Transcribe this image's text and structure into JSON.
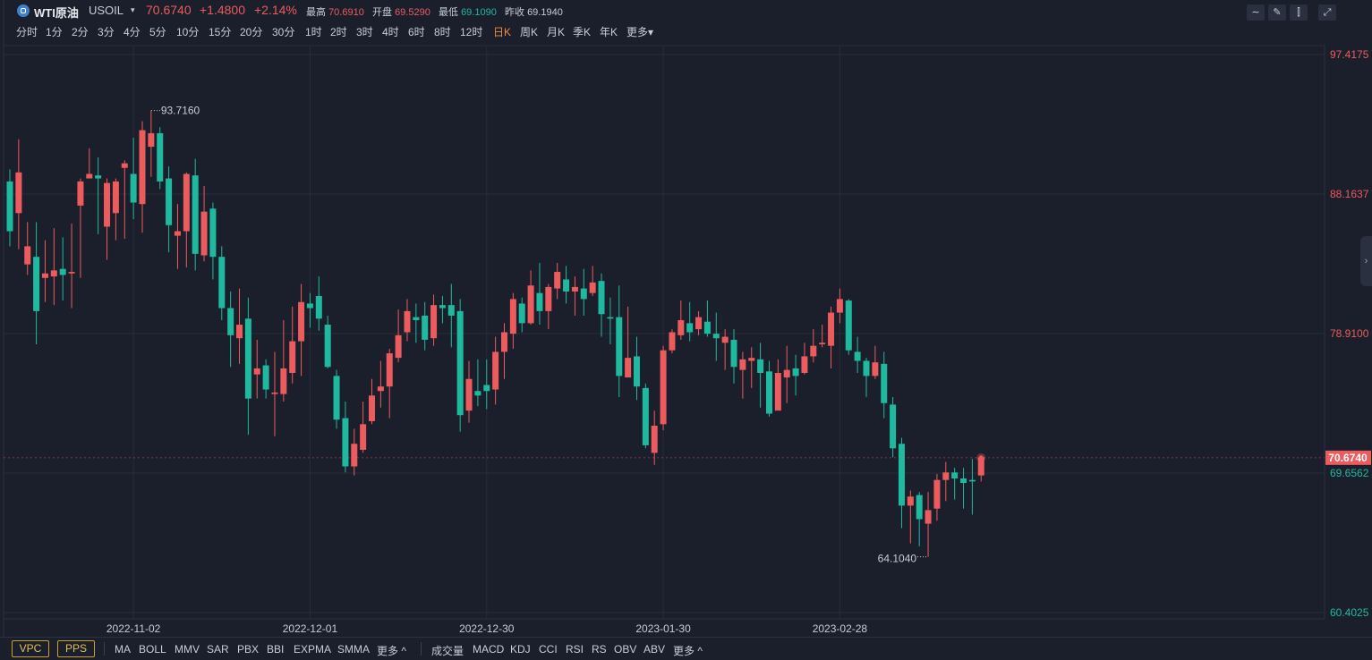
{
  "header": {
    "symbol_name": "WTI原油",
    "symbol_code": "USOIL",
    "caret": "▾",
    "last_price": "70.6740",
    "change": "+1.4800",
    "change_pct": "+2.14%",
    "high_label": "最高",
    "high_value": "70.6910",
    "open_label": "开盘",
    "open_value": "69.5290",
    "low_label": "最低",
    "low_value": "69.1090",
    "prev_close_label": "昨收",
    "prev_close_value": "69.1940"
  },
  "tools": [
    "line-tool-icon",
    "pencil-icon",
    "candle-style-icon",
    "fullscreen-icon"
  ],
  "periods": [
    "分时",
    "1分",
    "2分",
    "3分",
    "4分",
    "5分",
    "10分",
    "15分",
    "20分",
    "30分",
    "1时",
    "2时",
    "3时",
    "4时",
    "6时",
    "8时",
    "12时",
    "日K",
    "周K",
    "月K",
    "季K",
    "年K",
    "更多▾"
  ],
  "active_period": "日K",
  "bottom": {
    "left_boxed": [
      "VPC",
      "PPS"
    ],
    "main_indicators": [
      "MA",
      "BOLL",
      "MMV",
      "SAR",
      "PBX",
      "BBI",
      "EXPMA",
      "SMMA",
      "更多 ^"
    ],
    "sub_indicators": [
      "成交量",
      "MACD",
      "KDJ",
      "CCI",
      "RSI",
      "RS",
      "OBV",
      "ABV",
      "更多 ^"
    ]
  },
  "colors": {
    "up": "#ec5b5e",
    "down": "#1fb9a0",
    "bg": "#1b1f2b",
    "grid": "#262c3a"
  },
  "chart_data": {
    "type": "candlestick",
    "ylim": [
      60.4025,
      97.4175
    ],
    "y_ticks": [
      "97.4175",
      "88.1637",
      "78.9100",
      "69.6562",
      "60.4025"
    ],
    "x_ticks": [
      "2022-11-02",
      "2022-12-01",
      "2022-12-30",
      "2023-01-30",
      "2023-02-28"
    ],
    "max_label": "93.7160",
    "min_label": "64.1040",
    "last_price_label": "70.6740",
    "candles": [
      [
        89.0,
        85.7,
        89.8,
        84.7
      ],
      [
        86.9,
        89.6,
        91.8,
        84.5
      ],
      [
        83.5,
        84.7,
        86.3,
        82.8
      ],
      [
        84.0,
        80.4,
        86.3,
        78.2
      ],
      [
        82.6,
        82.9,
        85.1,
        81.0
      ],
      [
        82.7,
        83.1,
        85.9,
        80.8
      ],
      [
        83.2,
        82.8,
        85.3,
        81.1
      ],
      [
        82.9,
        83.0,
        86.2,
        80.6
      ],
      [
        87.4,
        89.0,
        89.2,
        82.6
      ],
      [
        89.2,
        89.5,
        91.2,
        89.4
      ],
      [
        89.4,
        89.2,
        90.6,
        85.5
      ],
      [
        86.0,
        88.9,
        89.2,
        83.8
      ],
      [
        86.9,
        89.0,
        89.2,
        85.1
      ],
      [
        89.9,
        90.2,
        90.4,
        85.2
      ],
      [
        89.5,
        87.6,
        91.9,
        86.5
      ],
      [
        87.5,
        92.4,
        93.0,
        85.6
      ],
      [
        91.3,
        92.2,
        93.7,
        89.3
      ],
      [
        92.2,
        89.0,
        92.6,
        88.5
      ],
      [
        89.2,
        86.1,
        90.0,
        84.3
      ],
      [
        85.4,
        85.7,
        87.5,
        83.2
      ],
      [
        85.7,
        89.5,
        89.6,
        83.3
      ],
      [
        89.4,
        84.2,
        90.5,
        83.1
      ],
      [
        84.1,
        87.0,
        88.7,
        83.7
      ],
      [
        87.2,
        84.0,
        87.6,
        82.5
      ],
      [
        84.0,
        80.6,
        84.7,
        79.8
      ],
      [
        80.6,
        78.8,
        81.7,
        76.7
      ],
      [
        78.6,
        79.5,
        81.9,
        76.9
      ],
      [
        79.9,
        74.6,
        81.3,
        72.2
      ],
      [
        76.2,
        76.6,
        78.5,
        74.6
      ],
      [
        76.8,
        75.2,
        77.2,
        74.6
      ],
      [
        74.9,
        75.0,
        77.7,
        72.1
      ],
      [
        74.9,
        76.6,
        79.8,
        74.4
      ],
      [
        76.3,
        78.4,
        80.7,
        75.6
      ],
      [
        78.4,
        81.0,
        82.2,
        76.1
      ],
      [
        80.9,
        80.6,
        81.6,
        79.3
      ],
      [
        81.4,
        79.9,
        82.7,
        79.1
      ],
      [
        79.5,
        76.7,
        80.1,
        76.6
      ],
      [
        76.1,
        73.2,
        76.5,
        72.6
      ],
      [
        73.3,
        70.1,
        74.4,
        69.7
      ],
      [
        70.1,
        71.6,
        72.6,
        69.5
      ],
      [
        71.2,
        72.9,
        74.4,
        71.0
      ],
      [
        73.1,
        74.8,
        75.9,
        72.9
      ],
      [
        75.1,
        75.4,
        77.1,
        74.0
      ],
      [
        75.4,
        77.6,
        77.9,
        73.3
      ],
      [
        77.3,
        78.8,
        80.5,
        77.0
      ],
      [
        79.0,
        80.4,
        81.2,
        78.4
      ],
      [
        80.0,
        79.8,
        80.9,
        78.3
      ],
      [
        80.1,
        78.5,
        81.0,
        77.8
      ],
      [
        78.6,
        80.8,
        81.5,
        78.1
      ],
      [
        80.8,
        80.6,
        81.4,
        79.6
      ],
      [
        80.8,
        80.1,
        82.2,
        78.0
      ],
      [
        80.4,
        73.5,
        81.2,
        72.4
      ],
      [
        73.8,
        75.9,
        77.1,
        73.0
      ],
      [
        75.1,
        74.8,
        77.2,
        74.1
      ],
      [
        75.5,
        75.1,
        77.2,
        73.9
      ],
      [
        75.2,
        77.7,
        78.7,
        74.2
      ],
      [
        77.7,
        79.0,
        79.6,
        75.9
      ],
      [
        78.9,
        81.2,
        81.6,
        77.9
      ],
      [
        80.9,
        79.6,
        81.3,
        79.0
      ],
      [
        79.6,
        82.1,
        83.1,
        79.5
      ],
      [
        81.6,
        80.4,
        83.6,
        79.5
      ],
      [
        80.4,
        82.0,
        82.2,
        79.2
      ],
      [
        81.9,
        83.0,
        83.6,
        81.2
      ],
      [
        82.5,
        81.7,
        83.4,
        80.9
      ],
      [
        81.7,
        82.0,
        82.7,
        80.1
      ],
      [
        81.9,
        81.2,
        83.2,
        80.1
      ],
      [
        81.6,
        82.3,
        83.4,
        81.4
      ],
      [
        82.4,
        80.2,
        82.9,
        78.7
      ],
      [
        80.0,
        79.9,
        81.3,
        78.2
      ],
      [
        80.0,
        76.1,
        82.1,
        74.7
      ],
      [
        76.0,
        77.3,
        80.7,
        76.1
      ],
      [
        77.4,
        75.4,
        78.7,
        74.5
      ],
      [
        75.3,
        71.5,
        75.6,
        71.3
      ],
      [
        71.0,
        72.8,
        73.8,
        70.2
      ],
      [
        72.9,
        77.8,
        78.1,
        72.5
      ],
      [
        77.8,
        79.0,
        79.2,
        77.6
      ],
      [
        78.8,
        79.8,
        81.1,
        78.5
      ],
      [
        79.6,
        79.0,
        81.0,
        78.4
      ],
      [
        79.2,
        80.0,
        80.4,
        78.8
      ],
      [
        79.7,
        78.9,
        81.1,
        78.7
      ],
      [
        78.9,
        78.6,
        80.3,
        77.1
      ],
      [
        78.3,
        78.7,
        79.2,
        76.5
      ],
      [
        78.5,
        76.7,
        79.2,
        75.6
      ],
      [
        76.5,
        77.2,
        77.7,
        74.6
      ],
      [
        77.1,
        77.3,
        78.0,
        75.3
      ],
      [
        77.2,
        76.3,
        78.3,
        74.0
      ],
      [
        76.4,
        73.6,
        77.1,
        73.4
      ],
      [
        73.8,
        76.3,
        77.2,
        74.5
      ],
      [
        76.0,
        76.5,
        78.1,
        74.3
      ],
      [
        76.6,
        76.1,
        77.5,
        74.8
      ],
      [
        76.3,
        77.4,
        78.3,
        76.2
      ],
      [
        77.4,
        78.1,
        79.2,
        77.0
      ],
      [
        78.2,
        78.3,
        79.5,
        78.0
      ],
      [
        78.1,
        80.3,
        80.7,
        76.6
      ],
      [
        80.3,
        81.2,
        81.9,
        79.6
      ],
      [
        81.1,
        77.8,
        81.2,
        77.5
      ],
      [
        77.7,
        77.1,
        78.7,
        76.3
      ],
      [
        77.1,
        76.1,
        77.3,
        74.7
      ],
      [
        76.1,
        77.0,
        78.1,
        75.9
      ],
      [
        76.9,
        74.3,
        77.7,
        73.3
      ],
      [
        74.2,
        71.3,
        74.7,
        70.7
      ],
      [
        71.6,
        67.5,
        72.0,
        66.0
      ],
      [
        67.5,
        68.1,
        68.5,
        65.0
      ],
      [
        68.2,
        66.6,
        68.4,
        64.8
      ],
      [
        66.3,
        67.2,
        68.4,
        64.1
      ],
      [
        67.3,
        69.2,
        69.6,
        66.5
      ],
      [
        69.2,
        69.7,
        70.4,
        67.8
      ],
      [
        69.7,
        69.3,
        70.0,
        67.9
      ],
      [
        69.3,
        69.0,
        70.0,
        67.3
      ],
      [
        69.2,
        69.1,
        70.6,
        66.9
      ],
      [
        69.5,
        70.7,
        70.7,
        69.1
      ]
    ]
  }
}
